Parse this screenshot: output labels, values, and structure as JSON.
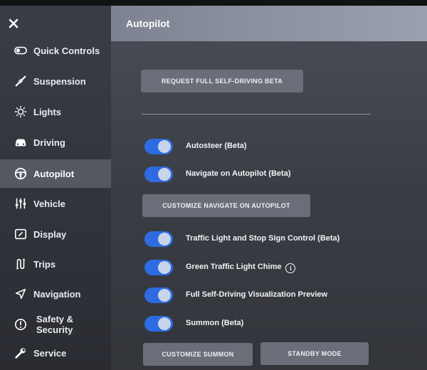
{
  "header": {
    "title": "Autopilot"
  },
  "sidebar": {
    "items": [
      {
        "label": "Quick Controls",
        "icon": "toggle-switch-icon"
      },
      {
        "label": "Suspension",
        "icon": "suspension-icon"
      },
      {
        "label": "Lights",
        "icon": "sun-icon"
      },
      {
        "label": "Driving",
        "icon": "car-icon"
      },
      {
        "label": "Autopilot",
        "icon": "steering-wheel-icon",
        "active": true
      },
      {
        "label": "Vehicle",
        "icon": "sliders-icon"
      },
      {
        "label": "Display",
        "icon": "display-icon"
      },
      {
        "label": "Trips",
        "icon": "trips-icon"
      },
      {
        "label": "Navigation",
        "icon": "navigation-arrow-icon"
      },
      {
        "label_line1": "Safety &",
        "label_line2": "Security",
        "icon": "alert-circle-icon"
      },
      {
        "label": "Service",
        "icon": "wrench-icon"
      }
    ]
  },
  "main": {
    "request_fsd_button": "REQUEST FULL SELF-DRIVING BETA",
    "customize_nav_button": "CUSTOMIZE NAVIGATE ON AUTOPILOT",
    "customize_summon_button": "CUSTOMIZE SUMMON",
    "standby_mode_button": "STANDBY MODE",
    "toggles": [
      {
        "label": "Autosteer (Beta)",
        "on": true
      },
      {
        "label": "Navigate on Autopilot (Beta)",
        "on": true
      },
      {
        "label": "Traffic Light and Stop Sign Control (Beta)",
        "on": true
      },
      {
        "label": "Green Traffic Light Chime",
        "on": true,
        "info": true
      },
      {
        "label": "Full Self-Driving Visualization Preview",
        "on": true
      },
      {
        "label": "Summon (Beta)",
        "on": true
      }
    ]
  },
  "colors": {
    "toggle_on": "#2e6be0",
    "active_nav": "#545860",
    "header": "#8f95a4"
  }
}
